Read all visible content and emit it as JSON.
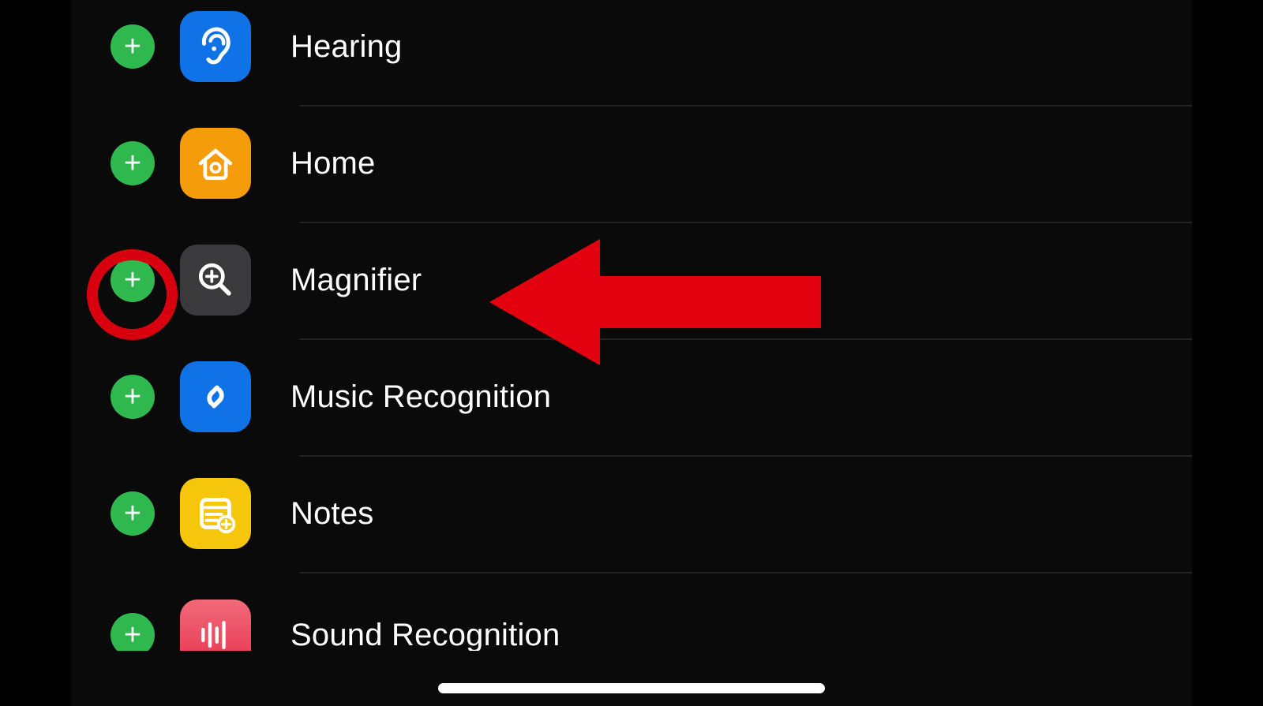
{
  "rows": [
    {
      "id": "hearing",
      "label": "Hearing",
      "icon_name": "ear-icon",
      "icon_bg": "#0f72e6"
    },
    {
      "id": "home",
      "label": "Home",
      "icon_name": "house-icon",
      "icon_bg": "#f59c0b"
    },
    {
      "id": "magnifier",
      "label": "Magnifier",
      "icon_name": "magnifier-plus-icon",
      "icon_bg": "#3a3a3c"
    },
    {
      "id": "music_recognition",
      "label": "Music Recognition",
      "icon_name": "shazam-icon",
      "icon_bg": "#0f72e6"
    },
    {
      "id": "notes",
      "label": "Notes",
      "icon_name": "notes-icon",
      "icon_bg": "#f5c60b"
    },
    {
      "id": "sound_recognition",
      "label": "Sound Recognition",
      "icon_name": "waveform-icon",
      "icon_bg": "#ed4a5c",
      "partial": true
    }
  ],
  "annotation": {
    "highlight_row": "magnifier",
    "circle_target": "add-button",
    "arrow_color": "#e3000f"
  }
}
